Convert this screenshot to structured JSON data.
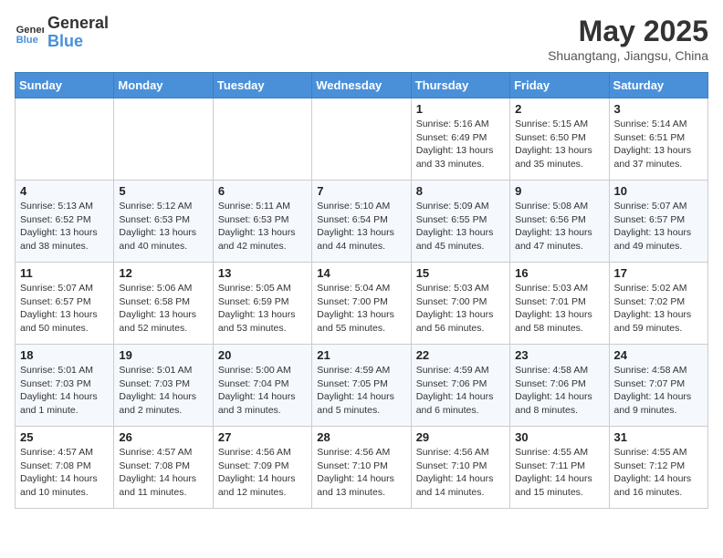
{
  "header": {
    "logo_line1": "General",
    "logo_line2": "Blue",
    "month": "May 2025",
    "location": "Shuangtang, Jiangsu, China"
  },
  "weekdays": [
    "Sunday",
    "Monday",
    "Tuesday",
    "Wednesday",
    "Thursday",
    "Friday",
    "Saturday"
  ],
  "weeks": [
    [
      {
        "day": "",
        "info": ""
      },
      {
        "day": "",
        "info": ""
      },
      {
        "day": "",
        "info": ""
      },
      {
        "day": "",
        "info": ""
      },
      {
        "day": "1",
        "info": "Sunrise: 5:16 AM\nSunset: 6:49 PM\nDaylight: 13 hours\nand 33 minutes."
      },
      {
        "day": "2",
        "info": "Sunrise: 5:15 AM\nSunset: 6:50 PM\nDaylight: 13 hours\nand 35 minutes."
      },
      {
        "day": "3",
        "info": "Sunrise: 5:14 AM\nSunset: 6:51 PM\nDaylight: 13 hours\nand 37 minutes."
      }
    ],
    [
      {
        "day": "4",
        "info": "Sunrise: 5:13 AM\nSunset: 6:52 PM\nDaylight: 13 hours\nand 38 minutes."
      },
      {
        "day": "5",
        "info": "Sunrise: 5:12 AM\nSunset: 6:53 PM\nDaylight: 13 hours\nand 40 minutes."
      },
      {
        "day": "6",
        "info": "Sunrise: 5:11 AM\nSunset: 6:53 PM\nDaylight: 13 hours\nand 42 minutes."
      },
      {
        "day": "7",
        "info": "Sunrise: 5:10 AM\nSunset: 6:54 PM\nDaylight: 13 hours\nand 44 minutes."
      },
      {
        "day": "8",
        "info": "Sunrise: 5:09 AM\nSunset: 6:55 PM\nDaylight: 13 hours\nand 45 minutes."
      },
      {
        "day": "9",
        "info": "Sunrise: 5:08 AM\nSunset: 6:56 PM\nDaylight: 13 hours\nand 47 minutes."
      },
      {
        "day": "10",
        "info": "Sunrise: 5:07 AM\nSunset: 6:57 PM\nDaylight: 13 hours\nand 49 minutes."
      }
    ],
    [
      {
        "day": "11",
        "info": "Sunrise: 5:07 AM\nSunset: 6:57 PM\nDaylight: 13 hours\nand 50 minutes."
      },
      {
        "day": "12",
        "info": "Sunrise: 5:06 AM\nSunset: 6:58 PM\nDaylight: 13 hours\nand 52 minutes."
      },
      {
        "day": "13",
        "info": "Sunrise: 5:05 AM\nSunset: 6:59 PM\nDaylight: 13 hours\nand 53 minutes."
      },
      {
        "day": "14",
        "info": "Sunrise: 5:04 AM\nSunset: 7:00 PM\nDaylight: 13 hours\nand 55 minutes."
      },
      {
        "day": "15",
        "info": "Sunrise: 5:03 AM\nSunset: 7:00 PM\nDaylight: 13 hours\nand 56 minutes."
      },
      {
        "day": "16",
        "info": "Sunrise: 5:03 AM\nSunset: 7:01 PM\nDaylight: 13 hours\nand 58 minutes."
      },
      {
        "day": "17",
        "info": "Sunrise: 5:02 AM\nSunset: 7:02 PM\nDaylight: 13 hours\nand 59 minutes."
      }
    ],
    [
      {
        "day": "18",
        "info": "Sunrise: 5:01 AM\nSunset: 7:03 PM\nDaylight: 14 hours\nand 1 minute."
      },
      {
        "day": "19",
        "info": "Sunrise: 5:01 AM\nSunset: 7:03 PM\nDaylight: 14 hours\nand 2 minutes."
      },
      {
        "day": "20",
        "info": "Sunrise: 5:00 AM\nSunset: 7:04 PM\nDaylight: 14 hours\nand 3 minutes."
      },
      {
        "day": "21",
        "info": "Sunrise: 4:59 AM\nSunset: 7:05 PM\nDaylight: 14 hours\nand 5 minutes."
      },
      {
        "day": "22",
        "info": "Sunrise: 4:59 AM\nSunset: 7:06 PM\nDaylight: 14 hours\nand 6 minutes."
      },
      {
        "day": "23",
        "info": "Sunrise: 4:58 AM\nSunset: 7:06 PM\nDaylight: 14 hours\nand 8 minutes."
      },
      {
        "day": "24",
        "info": "Sunrise: 4:58 AM\nSunset: 7:07 PM\nDaylight: 14 hours\nand 9 minutes."
      }
    ],
    [
      {
        "day": "25",
        "info": "Sunrise: 4:57 AM\nSunset: 7:08 PM\nDaylight: 14 hours\nand 10 minutes."
      },
      {
        "day": "26",
        "info": "Sunrise: 4:57 AM\nSunset: 7:08 PM\nDaylight: 14 hours\nand 11 minutes."
      },
      {
        "day": "27",
        "info": "Sunrise: 4:56 AM\nSunset: 7:09 PM\nDaylight: 14 hours\nand 12 minutes."
      },
      {
        "day": "28",
        "info": "Sunrise: 4:56 AM\nSunset: 7:10 PM\nDaylight: 14 hours\nand 13 minutes."
      },
      {
        "day": "29",
        "info": "Sunrise: 4:56 AM\nSunset: 7:10 PM\nDaylight: 14 hours\nand 14 minutes."
      },
      {
        "day": "30",
        "info": "Sunrise: 4:55 AM\nSunset: 7:11 PM\nDaylight: 14 hours\nand 15 minutes."
      },
      {
        "day": "31",
        "info": "Sunrise: 4:55 AM\nSunset: 7:12 PM\nDaylight: 14 hours\nand 16 minutes."
      }
    ]
  ]
}
